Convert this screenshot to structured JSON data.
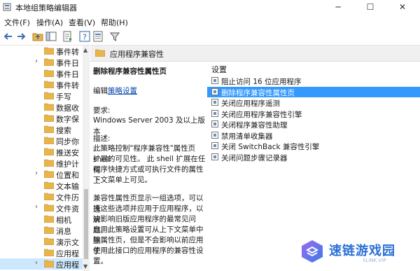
{
  "window": {
    "title": "本地组策略编辑器",
    "minimize": "─",
    "maximize": "☐",
    "close": "✕"
  },
  "menu": [
    "文件(F)",
    "操作(A)",
    "查看(V)",
    "帮助(H)"
  ],
  "toolbar": {
    "icons": [
      "back-icon",
      "forward-icon",
      "folder-up-icon",
      "show-tree-icon",
      "export-icon",
      "help-icon",
      "properties-icon",
      "filter-icon"
    ]
  },
  "tree": {
    "items": [
      {
        "label": "事件转",
        "arrow": ""
      },
      {
        "label": "事件日",
        "arrow": "›"
      },
      {
        "label": "事件日",
        "arrow": ""
      },
      {
        "label": "事件转",
        "arrow": ""
      },
      {
        "label": "手写",
        "arrow": ""
      },
      {
        "label": "数据收",
        "arrow": ""
      },
      {
        "label": "数字保",
        "arrow": ""
      },
      {
        "label": "搜索",
        "arrow": ""
      },
      {
        "label": "同步你",
        "arrow": ""
      },
      {
        "label": "推送安",
        "arrow": ""
      },
      {
        "label": "维护计",
        "arrow": ""
      },
      {
        "label": "位置和",
        "arrow": "›"
      },
      {
        "label": "文本输",
        "arrow": ""
      },
      {
        "label": "文件历",
        "arrow": ""
      },
      {
        "label": "文件资",
        "arrow": "›"
      },
      {
        "label": "相机",
        "arrow": ""
      },
      {
        "label": "消息",
        "arrow": ""
      },
      {
        "label": "演示文",
        "arrow": ""
      },
      {
        "label": "应用程",
        "arrow": ""
      },
      {
        "label": "应用程",
        "arrow": "›"
      }
    ]
  },
  "header": {
    "title": "应用程序兼容性"
  },
  "description": {
    "policy_name": "删除程序兼容性属性页",
    "edit_prefix": "编辑",
    "edit_link": "策略设置",
    "requirements_label": "要求:",
    "requirements_value": "Windows Server 2003 及以上版本",
    "desc_label": "描述:",
    "desc_lines": [
      "此策略控制\"程序兼容性\"属性页 shell",
      "扩展的可见性。 此 shell 扩展在任何",
      "程序快捷方式或可执行文件的属性上",
      "下文菜单上可见。"
    ],
    "desc_lines2": [
      "兼容性属性页显示一组选项，可以选",
      "择这些选项并应用于应用程序，以解",
      "决影响旧版应用程序的最常见问题。",
      "启用此策略设置可从上下文菜单中删",
      "除属性页，但是不会影响以前应用于",
      "使用此接口的应用程序的兼容性设",
      "置。"
    ]
  },
  "settings": {
    "header": "设置",
    "items": [
      "阻止访问 16 位应用程序",
      "删除程序兼容性属性页",
      "关闭应用程序遥测",
      "关闭应用程序兼容性引擎",
      "关闭程序兼容性助理",
      "禁用清单收集器",
      "关闭 SwitchBack 兼容性引擎",
      "关闭问题步骤记录器"
    ],
    "selected_index": 1
  },
  "watermark": {
    "text": "速链游戏园",
    "sub": "SLINK.VIP"
  },
  "colors": {
    "selection": "#3399ff",
    "tree_selection": "#cce8ff",
    "folder": "#e8b54a",
    "link": "#0645ad",
    "watermark": "#2a6fd6"
  }
}
